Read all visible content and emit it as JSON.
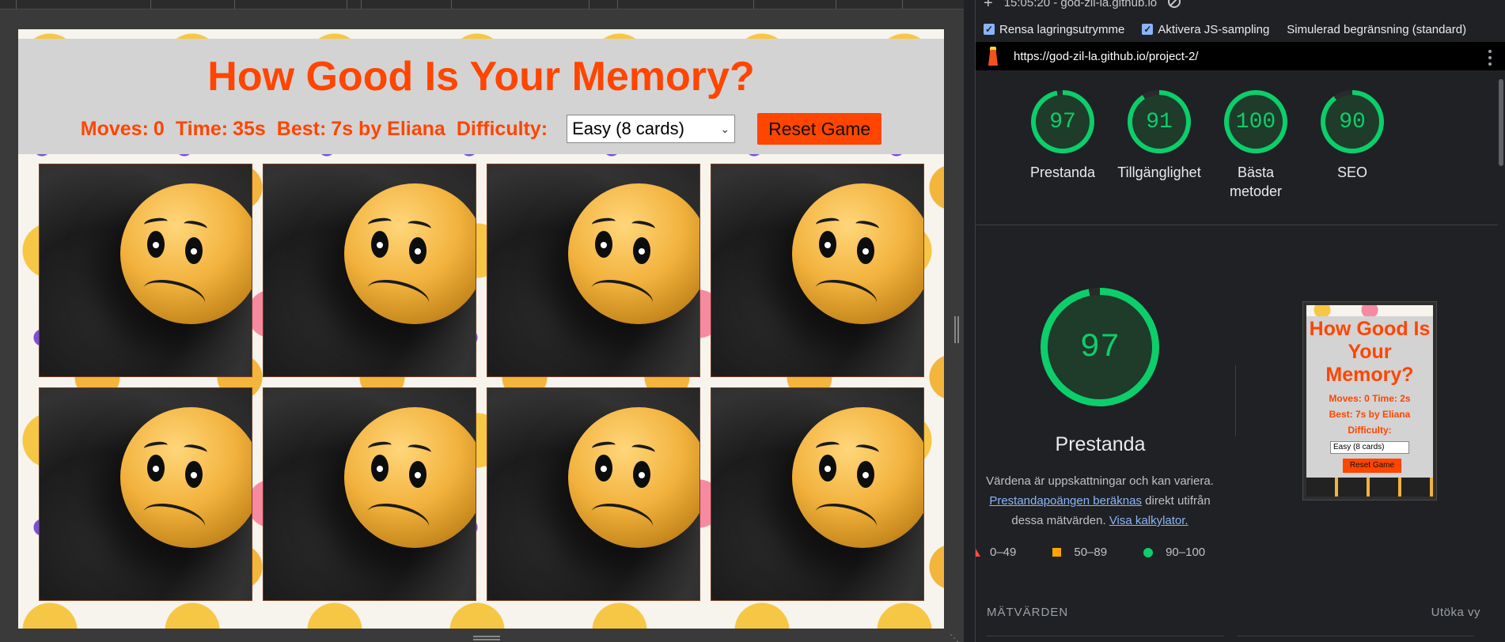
{
  "game": {
    "title": "How Good Is Your Memory?",
    "moves_label": "Moves:",
    "moves_value": "0",
    "time_label": "Time:",
    "time_value": "35s",
    "best_label": "Best:",
    "best_value": "7s by Eliana",
    "difficulty_label": "Difficulty:",
    "difficulty_selected": "Easy (8 cards)",
    "reset_label": "Reset Game",
    "card_count": 8,
    "accent_color": "#ff4500"
  },
  "devtools": {
    "session": "15:05:20 - god-zil-la.github.io",
    "options": [
      {
        "label": "Rensa lagringsutrymme",
        "checked": true
      },
      {
        "label": "Aktivera JS-sampling",
        "checked": true
      }
    ],
    "throttling": "Simulerad begränsning (standard)",
    "url": "https://god-zil-la.github.io/project-2/",
    "scores": [
      {
        "label": "Prestanda",
        "value": 97
      },
      {
        "label": "Tillgänglighet",
        "value": 91
      },
      {
        "label": "Bästa metoder",
        "value": 100
      },
      {
        "label": "SEO",
        "value": 90
      }
    ],
    "performance": {
      "score": 97,
      "label": "Prestanda",
      "desc_1": "Värdena är uppskattningar och kan variera.",
      "desc_link_1": "Prestandapoängen beräknas",
      "desc_2": "direkt utifrån dessa mätvärden.",
      "desc_link_2": "Visa kalkylator."
    },
    "thumbnail": {
      "title": "How Good Is Your Memory?",
      "stats": "Moves: 0  Time: 2s",
      "best": "Best: 7s by Eliana",
      "difficulty": "Difficulty:",
      "select": "Easy (8 cards)",
      "button": "Reset Game"
    },
    "legend": [
      {
        "range": "0–49",
        "color": "#ff4e42"
      },
      {
        "range": "50–89",
        "color": "#ffa400"
      },
      {
        "range": "90–100",
        "color": "#0cce6b"
      }
    ],
    "metrics_heading": "MÄTVÄRDEN",
    "expand_label": "Utöka vy",
    "good_color": "#0cce6b"
  }
}
